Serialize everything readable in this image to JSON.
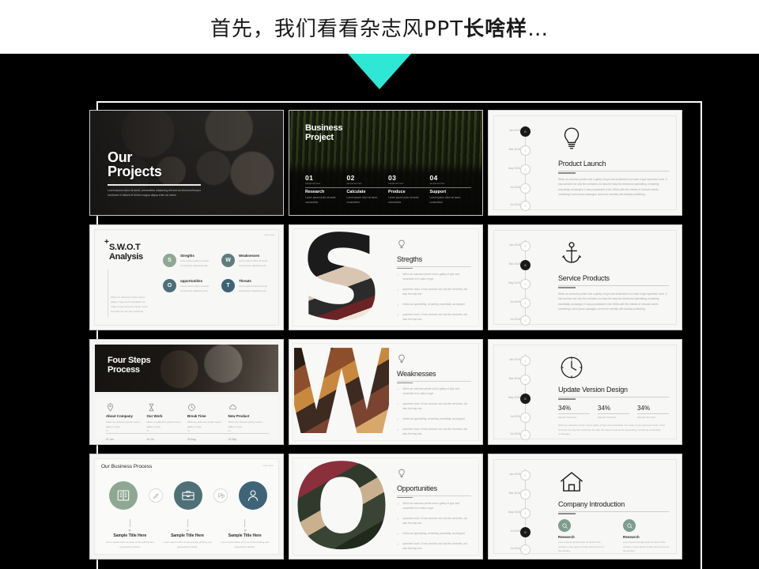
{
  "header": {
    "title_plain": "首先，我们看看杂志风PPT",
    "title_bold": "长啥样",
    "title_ellipsis": "…"
  },
  "arrow": {
    "name": "down-triangle",
    "color": "#2ee8d5"
  },
  "slides": [
    {
      "id": "our-projects",
      "kind": "photo-title",
      "title_line1": "Our",
      "title_line2": "Projects",
      "subtext": "Lorem ipsum dolor sit amet, consectetur adipiscing elit sed do eiusmod tempor incididunt ut labore et dolore magna aliqua enim ad minim"
    },
    {
      "id": "business-project",
      "kind": "photo-steps",
      "title_line1": "Business",
      "title_line2": "Project",
      "steps": [
        {
          "num": "01",
          "numsub": "sample text here",
          "label": "Research",
          "text": "Lorem ipsum dolor sit amet, consectetur"
        },
        {
          "num": "02",
          "numsub": "sample text here",
          "label": "Calculate",
          "text": "Lorem ipsum dolor sit amet, consectetur"
        },
        {
          "num": "03",
          "numsub": "sample text here",
          "label": "Produce",
          "text": "Lorem ipsum dolor sit amet, consectetur"
        },
        {
          "num": "04",
          "numsub": "sample text here",
          "label": "Support",
          "text": "Lorem ipsum dolor sit amet, consectetur"
        }
      ]
    },
    {
      "id": "product-launch",
      "kind": "timeline",
      "icon": "lightbulb-icon",
      "title": "Product Launch",
      "subtitle": "sample text here",
      "body": "When an unknown printer took a galley of type and scrambled it to make a type specimen book. It has survived not only five centuries, but also the leap into electronic typesetting, remaining essentially unchanged. It was popularised in the 1960s with the release of Letraset sheets containing Lorem Ipsum passages, and more recently with desktop publishing.",
      "dates": [
        "Jan 2016",
        "Mar 2016",
        "May 2016",
        "Jul 2016",
        "Jul 2016"
      ],
      "active_index": 0
    },
    {
      "id": "swot-analysis",
      "kind": "swot",
      "plus": "+",
      "title_line1": "S.W.O.T",
      "title_line2": "Analysis",
      "footnote": "When an unknown printer took a galley of type and scrambled it to make a type specimen book. It has survived not only five centuries",
      "logo": "Logo\nHere",
      "items": [
        {
          "letter": "S",
          "heading": "Stregths",
          "text": "Lorem ipsum dolor sit amet consectetur adipiscing elit",
          "color": "#8fa894"
        },
        {
          "letter": "W",
          "heading": "Weaknesses",
          "text": "Lorem ipsum dolor sit amet consectetur adipiscing elit",
          "color": "#5f7d7c"
        },
        {
          "letter": "O",
          "heading": "opportunities",
          "text": "Lorem ipsum dolor sit amet consectetur adipiscing elit",
          "color": "#4d6f79"
        },
        {
          "letter": "T",
          "heading": "Threats",
          "text": "Lorem ipsum dolor sit amet consectetur adipiscing elit",
          "color": "#3f6477"
        }
      ]
    },
    {
      "id": "strengths",
      "kind": "big-letter",
      "letter": "S",
      "icon": "lightbulb-icon",
      "title": "Stregths",
      "bullets": [
        "When an unknown printer took a galley of type and scrambled it to make a type",
        "specimen book. It has survived not only five centuries, but also the leap into",
        "electronic typesetting, remaining essentially unchanged",
        "specimen book. It has survived not only five centuries, but also the leap into"
      ]
    },
    {
      "id": "service-products",
      "kind": "timeline",
      "icon": "anchor-icon",
      "title": "Service Products",
      "subtitle": "sample text here",
      "body": "When an unknown printer took a galley of type and scrambled it to make a type specimen book. It has survived not only five centuries, but also the leap into electronic typesetting, remaining essentially unchanged. It was popularised in the 1960s with the release of Letraset sheets containing Lorem Ipsum passages, and more recently with desktop publishing.",
      "dates": [
        "Jan 2016",
        "Mar 2016",
        "May 2016",
        "Jul 2016",
        "Jul 2016"
      ],
      "active_index": 1
    },
    {
      "id": "four-steps-process",
      "kind": "four-steps",
      "title_line1": "Four Steps",
      "title_line2": "Process",
      "columns": [
        {
          "icon": "location-pin-icon",
          "label": "About Company",
          "text": "When an unknown printer took a galley of type",
          "tick": "01",
          "date": "01 Jun"
        },
        {
          "icon": "hourglass-icon",
          "label": "Our Work",
          "text": "When an unknown printer took a galley of type",
          "tick": "02",
          "date": "14 Jul"
        },
        {
          "icon": "clock-icon",
          "label": "Break Time",
          "text": "When an unknown printer took a galley of type",
          "tick": "03",
          "date": "30 Aug"
        },
        {
          "icon": "cloud-icon",
          "label": "New Product",
          "text": "When an unknown printer took a galley of type",
          "tick": "04",
          "date": "13 Sep"
        }
      ]
    },
    {
      "id": "weaknesses",
      "kind": "big-letter",
      "letter": "W",
      "icon": "lightbulb-icon",
      "title": "Weaknesses",
      "bullets": [
        "When an unknown printer took a galley of type and scrambled it to make a type",
        "specimen book. It has survived not only five centuries, but also the leap into",
        "electronic typesetting, remaining essentially unchanged",
        "specimen book. It has survived not only five centuries, but also the leap into"
      ]
    },
    {
      "id": "update-version-design",
      "kind": "timeline-stats",
      "icon": "clock-icon",
      "title": "Update Version Design",
      "subtitle": "sample text here",
      "stats": [
        {
          "value": "34%",
          "label": "Sample Text here"
        },
        {
          "value": "34%",
          "label": "Sample Text here"
        },
        {
          "value": "34%",
          "label": "Sample Text here"
        }
      ],
      "note": "When an unknown printer took a galley of type and scrambled it to make a type specimen book. It has survived not only five centuries, but also the leap into electronic typesetting, remaining essentially unchanged.",
      "dates": [
        "Jan 2016",
        "Mar 2016",
        "May 2016",
        "Jul 2016",
        "Jul 2016"
      ],
      "active_index": 2
    },
    {
      "id": "our-business-process",
      "kind": "business-process",
      "title": "Our Business Process",
      "logo": "Logo\nHere",
      "big_circles": [
        {
          "icon": "book-icon",
          "color": "#8fa894"
        },
        {
          "icon": "briefcase-icon",
          "color": "#4f7076"
        },
        {
          "icon": "user-icon",
          "color": "#3f6477"
        }
      ],
      "small_circles": [
        {
          "icon": "pencil-icon"
        },
        {
          "icon": "chat-icon"
        }
      ],
      "captions": [
        {
          "heading": "Sample Title Here",
          "text": "Lorem ipsum dolor sit amet of the printing and typesetting industry"
        },
        {
          "heading": "Sample Title Here",
          "text": "Lorem ipsum dolor sit amet of the printing and typesetting industry"
        },
        {
          "heading": "Sample Title Here",
          "text": "Lorem ipsum dolor sit amet of the printing and typesetting industry"
        }
      ]
    },
    {
      "id": "opportunities",
      "kind": "big-letter",
      "letter": "O",
      "icon": "lightbulb-icon",
      "title": "Opportunities",
      "bullets": [
        "When an unknown printer took a galley of type and scrambled it to make a type",
        "specimen book. It has survived not only five centuries, but also the leap into",
        "electronic typesetting, remaining essentially unchanged",
        "specimen book. It has survived not only five centuries, but also the leap into"
      ]
    },
    {
      "id": "company-introduction",
      "kind": "timeline-research",
      "icon": "house-icon",
      "title": "Company Introduction",
      "subtitle": "sample text here",
      "blocks": [
        {
          "heading": "Research",
          "text": "Lorem ipsum simply dolor sit amet of the printing. Lorem ipsum simply dummy text of the printing."
        },
        {
          "heading": "Research",
          "text": "Lorem ipsum simply dolor sit amet of the printing. Lorem ipsum simply dummy text of the printing."
        }
      ],
      "dates": [
        "Jan 2016",
        "Mar 2016",
        "May 2016",
        "Jul 2016",
        "Jul 2016"
      ],
      "active_index": 3
    }
  ]
}
